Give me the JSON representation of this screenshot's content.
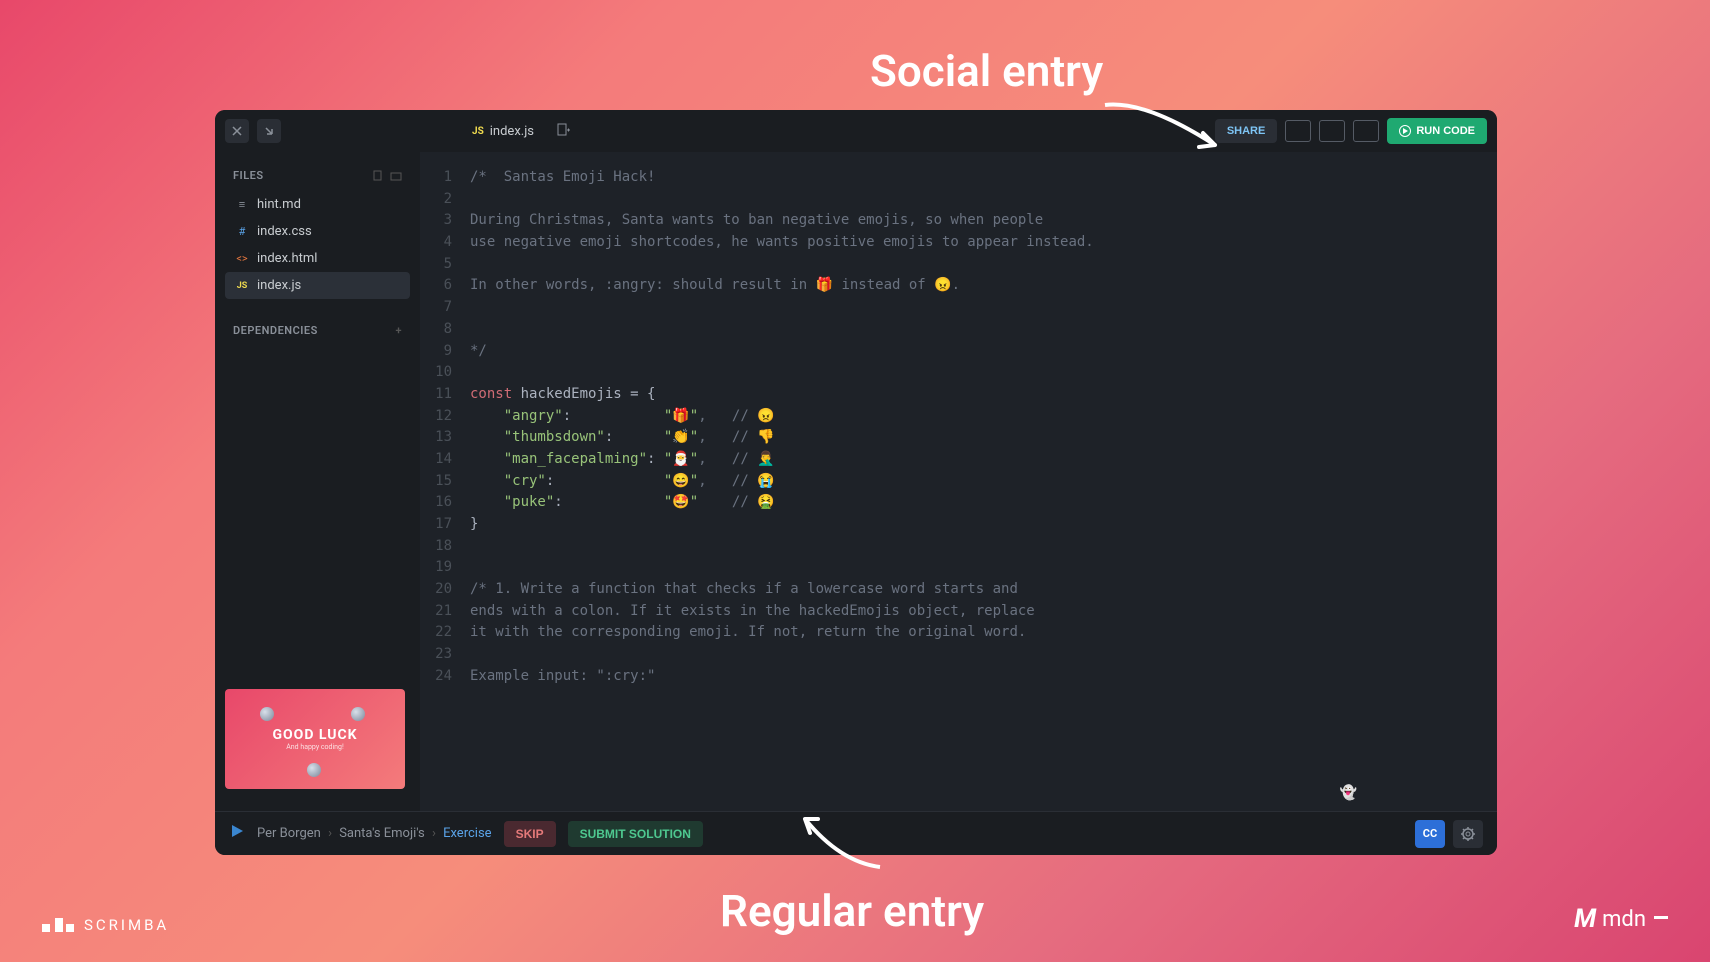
{
  "annotations": {
    "top": "Social entry",
    "bottom": "Regular entry"
  },
  "topbar": {
    "tab_filename": "index.js",
    "share_label": "SHARE",
    "run_label": "RUN CODE"
  },
  "sidebar": {
    "files_header": "FILES",
    "deps_header": "DEPENDENCIES",
    "files": [
      {
        "icon": "md",
        "name": "hint.md"
      },
      {
        "icon": "css",
        "name": "index.css"
      },
      {
        "icon": "html",
        "name": "index.html"
      },
      {
        "icon": "js",
        "name": "index.js"
      }
    ],
    "preview": {
      "title": "GOOD LUCK",
      "subtitle": "And happy coding!"
    }
  },
  "code": {
    "lines": [
      {
        "n": 1,
        "t": "comment",
        "text": "/*  Santas Emoji Hack!"
      },
      {
        "n": 2,
        "t": "blank",
        "text": ""
      },
      {
        "n": 3,
        "t": "comment",
        "text": "During Christmas, Santa wants to ban negative emojis, so when people"
      },
      {
        "n": 4,
        "t": "comment",
        "text": "use negative emoji shortcodes, he wants positive emojis to appear instead."
      },
      {
        "n": 5,
        "t": "blank",
        "text": ""
      },
      {
        "n": 6,
        "t": "comment",
        "text": "In other words, :angry: should result in 🎁 instead of 😠."
      },
      {
        "n": 7,
        "t": "blank",
        "text": ""
      },
      {
        "n": 8,
        "t": "blank",
        "text": ""
      },
      {
        "n": 9,
        "t": "comment",
        "text": "*/"
      },
      {
        "n": 10,
        "t": "blank",
        "text": ""
      },
      {
        "n": 11,
        "t": "decl"
      },
      {
        "n": 12,
        "t": "prop",
        "key": "\"angry\"",
        "pad": "           ",
        "val": "\"🎁\"",
        "com": ",   // 😠"
      },
      {
        "n": 13,
        "t": "prop",
        "key": "\"thumbsdown\"",
        "pad": "      ",
        "val": "\"👏\"",
        "com": ",   // 👎"
      },
      {
        "n": 14,
        "t": "prop",
        "key": "\"man_facepalming\"",
        "pad": " ",
        "val": "\"🎅\"",
        "com": ",   // 🤦‍♂️"
      },
      {
        "n": 15,
        "t": "prop",
        "key": "\"cry\"",
        "pad": "             ",
        "val": "\"😄\"",
        "com": ",   // 😭"
      },
      {
        "n": 16,
        "t": "prop",
        "key": "\"puke\"",
        "pad": "            ",
        "val": "\"🤩\"",
        "com": "    // 🤮"
      },
      {
        "n": 17,
        "t": "close"
      },
      {
        "n": 18,
        "t": "blank",
        "text": ""
      },
      {
        "n": 19,
        "t": "blank",
        "text": ""
      },
      {
        "n": 20,
        "t": "comment",
        "text": "/* 1. Write a function that checks if a lowercase word starts and"
      },
      {
        "n": 21,
        "t": "comment",
        "text": "ends with a colon. If it exists in the hackedEmojis object, replace"
      },
      {
        "n": 22,
        "t": "comment",
        "text": "it with the corresponding emoji. If not, return the original word."
      },
      {
        "n": 23,
        "t": "blank",
        "text": ""
      },
      {
        "n": 24,
        "t": "comment",
        "text": "Example input: \":cry:\""
      }
    ],
    "decl": {
      "kw": "const",
      "name": "hackedEmojis",
      "rest": " = {"
    },
    "close_brace": "}"
  },
  "bottombar": {
    "breadcrumb": {
      "author": "Per Borgen",
      "course": "Santa's Emoji's",
      "current": "Exercise"
    },
    "skip_label": "SKIP",
    "submit_label": "SUBMIT SOLUTION",
    "cc_label": "CC"
  },
  "logos": {
    "scrimba": "SCRIMBA",
    "mdn": "mdn"
  }
}
